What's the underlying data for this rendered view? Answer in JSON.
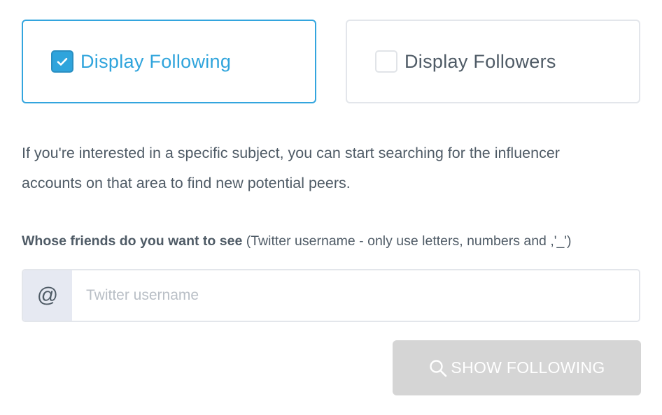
{
  "options": {
    "following": {
      "label": "Display Following",
      "checked": true
    },
    "followers": {
      "label": "Display Followers",
      "checked": false
    }
  },
  "description": "If you're interested in a specific subject, you can start searching for the influencer accounts on that area to find new potential peers.",
  "field": {
    "label": "Whose friends do you want to see",
    "hint": "(Twitter username - only use letters, numbers and ,'_')",
    "prefix": "@",
    "placeholder": "Twitter username",
    "value": ""
  },
  "button": {
    "label": "SHOW FOLLOWING",
    "icon": "search-icon",
    "enabled": false
  },
  "colors": {
    "accent": "#2fa4dc",
    "text": "#4f5b66",
    "border": "#e3e6eb",
    "addon_bg": "#e6e9f2",
    "button_disabled": "#d5d5d5"
  }
}
